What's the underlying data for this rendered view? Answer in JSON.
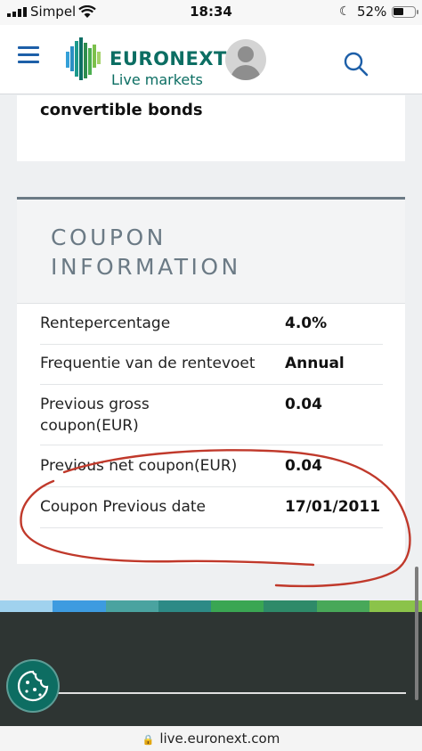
{
  "status_bar": {
    "carrier": "Simpel",
    "time": "18:34",
    "battery_percent": "52%",
    "battery_level": 0.52
  },
  "header": {
    "brand": "EURONEXT",
    "tagline": "Live markets"
  },
  "prev_section": {
    "text": "convertible bonds"
  },
  "coupon": {
    "title": "COUPON INFORMATION",
    "rows": [
      {
        "label": "Rentepercentage",
        "value": "4.0%"
      },
      {
        "label": "Frequentie van de rentevoet",
        "value": "Annual"
      },
      {
        "label": "Previous gross coupon(EUR)",
        "value": "0.04"
      },
      {
        "label": "Previous net coupon(EUR)",
        "value": "0.04"
      },
      {
        "label": "Coupon Previous date",
        "value": "17/01/2011"
      }
    ]
  },
  "browser": {
    "url": "live.euronext.com"
  },
  "colors": {
    "brand_green": "#0c6e63",
    "accent_blue": "#1d5fa8",
    "annotation_red": "#c0392b",
    "footer_dark": "#2e3533",
    "stripe": [
      "#a0d2ee",
      "#3d9be0",
      "#4aa3a0",
      "#2d8a86",
      "#3aa653",
      "#2e8a69",
      "#48a859",
      "#8bc34a"
    ]
  },
  "icons": [
    "menu-icon",
    "euronext-logo-icon",
    "avatar-icon",
    "search-icon",
    "cookie-icon",
    "lock-icon",
    "wifi-icon",
    "moon-icon"
  ]
}
